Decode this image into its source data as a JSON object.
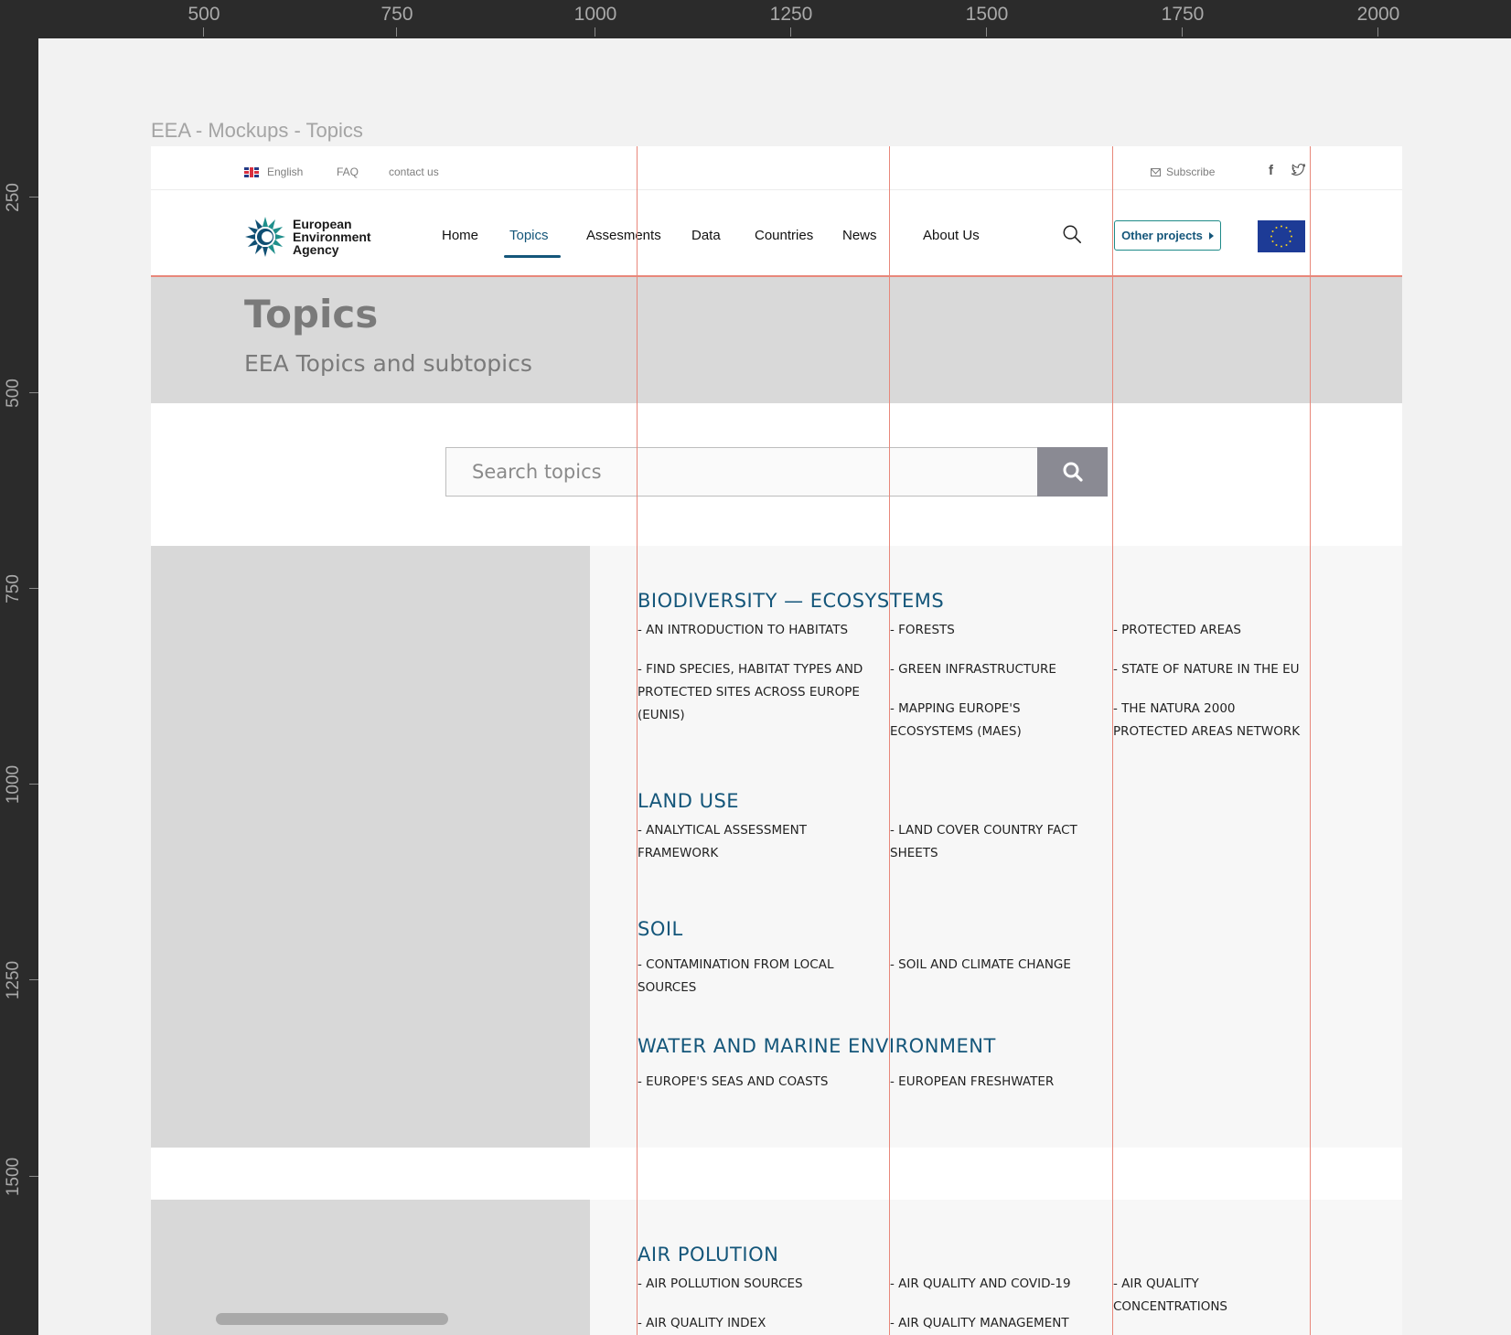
{
  "ruler": {
    "top": [
      "500",
      "750",
      "1000",
      "1250",
      "1500",
      "1750",
      "2000"
    ],
    "left": [
      "250",
      "500",
      "750",
      "1000",
      "1250",
      "1500"
    ]
  },
  "artboard_label": "EEA - Mockups - Topics",
  "topbar": {
    "language": "English",
    "faq": "FAQ",
    "contact": "contact us",
    "subscribe": "Subscribe",
    "facebook_glyph": "f"
  },
  "header": {
    "logo": [
      "European",
      "Environment",
      "Agency"
    ],
    "nav": [
      "Home",
      "Topics",
      "Assesments",
      "Data",
      "Countries",
      "News",
      "About Us"
    ],
    "active_nav": "Topics",
    "other_projects": "Other projects"
  },
  "hero": {
    "title": "Topics",
    "subtitle": "EEA Topics and subtopics"
  },
  "search": {
    "placeholder": "Search topics"
  },
  "topics": [
    {
      "title": "BIODIVERSITY — ECOSYSTEMS",
      "col1": [
        "- AN INTRODUCTION TO HABITATS",
        "- FIND SPECIES, HABITAT TYPES AND PROTECTED SITES ACROSS EUROPE (EUNIS)"
      ],
      "col2": [
        "- FORESTS",
        "- GREEN INFRASTRUCTURE",
        "- MAPPING EUROPE'S ECOSYSTEMS (MAES)"
      ],
      "col3": [
        "- PROTECTED AREAS",
        "- STATE OF NATURE IN THE EU",
        "- THE NATURA 2000 PROTECTED AREAS NETWORK"
      ]
    },
    {
      "title": "LAND USE",
      "col1": [
        "- ANALYTICAL ASSESSMENT FRAMEWORK"
      ],
      "col2": [
        "- LAND COVER COUNTRY FACT SHEETS"
      ],
      "col3": []
    },
    {
      "title": "SOIL",
      "col1": [
        "- CONTAMINATION FROM LOCAL SOURCES"
      ],
      "col2": [
        "- SOIL AND CLIMATE CHANGE"
      ],
      "col3": []
    },
    {
      "title": "WATER AND MARINE ENVIRONMENT",
      "col1": [
        "- EUROPE'S SEAS AND COASTS"
      ],
      "col2": [
        "- EUROPEAN FRESHWATER"
      ],
      "col3": []
    },
    {
      "title": "AIR POLUTION",
      "col1": [
        "- AIR POLLUTION SOURCES",
        "- AIR QUALITY INDEX"
      ],
      "col2": [
        "- AIR QUALITY AND COVID-19",
        "- AIR QUALITY MANAGEMENT"
      ],
      "col3": [
        "- AIR QUALITY CONCENTRATIONS"
      ]
    }
  ],
  "colors": {
    "accent": "#14567a",
    "guide": "#e8877a",
    "placeholder_block": "#d8d8d8"
  },
  "icons": [
    "uk-flag-icon",
    "envelope-icon",
    "facebook-icon",
    "twitter-icon",
    "eea-logo-icon",
    "search-icon",
    "caret-right-icon",
    "eu-flag-icon"
  ]
}
